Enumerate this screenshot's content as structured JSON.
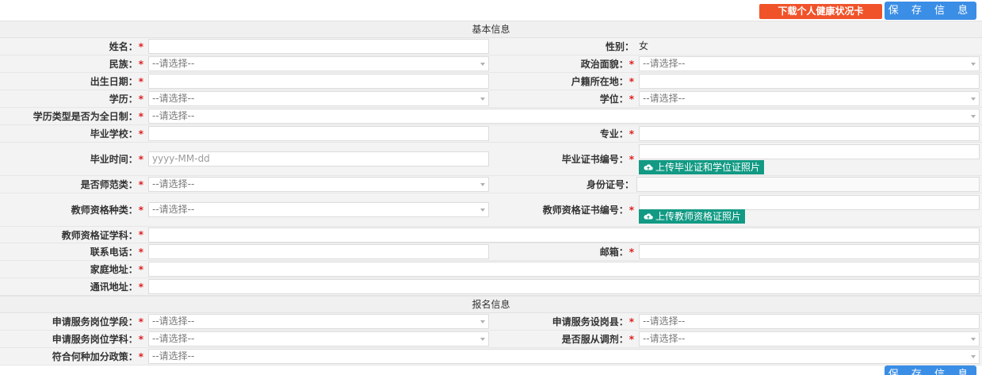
{
  "toolbar": {
    "health_card_label": "下载个人健康状况卡",
    "save_label": "保 存 信 息"
  },
  "sections": {
    "basic": "基本信息",
    "signup": "报名信息"
  },
  "required_mark": "*",
  "placeholders": {
    "select": "--请选择--",
    "date": "yyyy-MM-dd"
  },
  "fields": {
    "name": "姓名：",
    "gender": "性别：",
    "gender_value": "女",
    "ethnicity": "民族：",
    "political": "政治面貌：",
    "birth_date": "出生日期：",
    "hukou": "户籍所在地：",
    "education": "学历：",
    "degree": "学位：",
    "fulltime": "学历类型是否为全日制：",
    "school": "毕业学校：",
    "major": "专业：",
    "grad_time": "毕业时间：",
    "cert_no": "毕业证书编号：",
    "upload_grad": "上传毕业证和学位证照片",
    "normal_major": "是否师范类：",
    "id_no": "身份证号：",
    "teacher_cert_type": "教师资格种类：",
    "teacher_cert_no": "教师资格证书编号：",
    "upload_teacher": "上传教师资格证照片",
    "teacher_cert_subject": "教师资格证学科：",
    "phone": "联系电话：",
    "email": "邮箱：",
    "home_addr": "家庭地址：",
    "mail_addr": "通讯地址：",
    "apply_stage": "申请服务岗位学段：",
    "apply_county": "申请服务设岗县：",
    "apply_subject": "申请服务岗位学科：",
    "accept_transfer": "是否服从调剂：",
    "bonus_policy": "符合何种加分政策："
  }
}
